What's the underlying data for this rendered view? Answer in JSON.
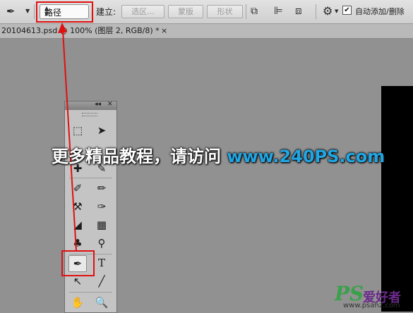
{
  "options_bar": {
    "pen_tool_icon": "pen-icon",
    "tool_mode_value": "路径",
    "make_label": "建立:",
    "selection_button": "选区...",
    "mask_button": "蒙版",
    "shape_button": "形状",
    "auto_add_delete_checked": true,
    "auto_add_delete_label": "自动添加/删除"
  },
  "document_tab": {
    "title": "20104613.psd @ 100% (图层 2, RGB/8) *",
    "close": "×"
  },
  "toolbox": {
    "header_collapse": "◂◂",
    "header_close": "✕",
    "selected_tool": "pen-tool"
  },
  "overlay": {
    "text": "更多精品教程，请访问 ",
    "url": "www.240PS.com"
  },
  "watermark": {
    "ps": "PS",
    "cn": "爱好者",
    "site": "www.psahz.com"
  },
  "colors": {
    "highlight": "#e01010",
    "canvas": "#919191",
    "url": "#21a6e3"
  }
}
